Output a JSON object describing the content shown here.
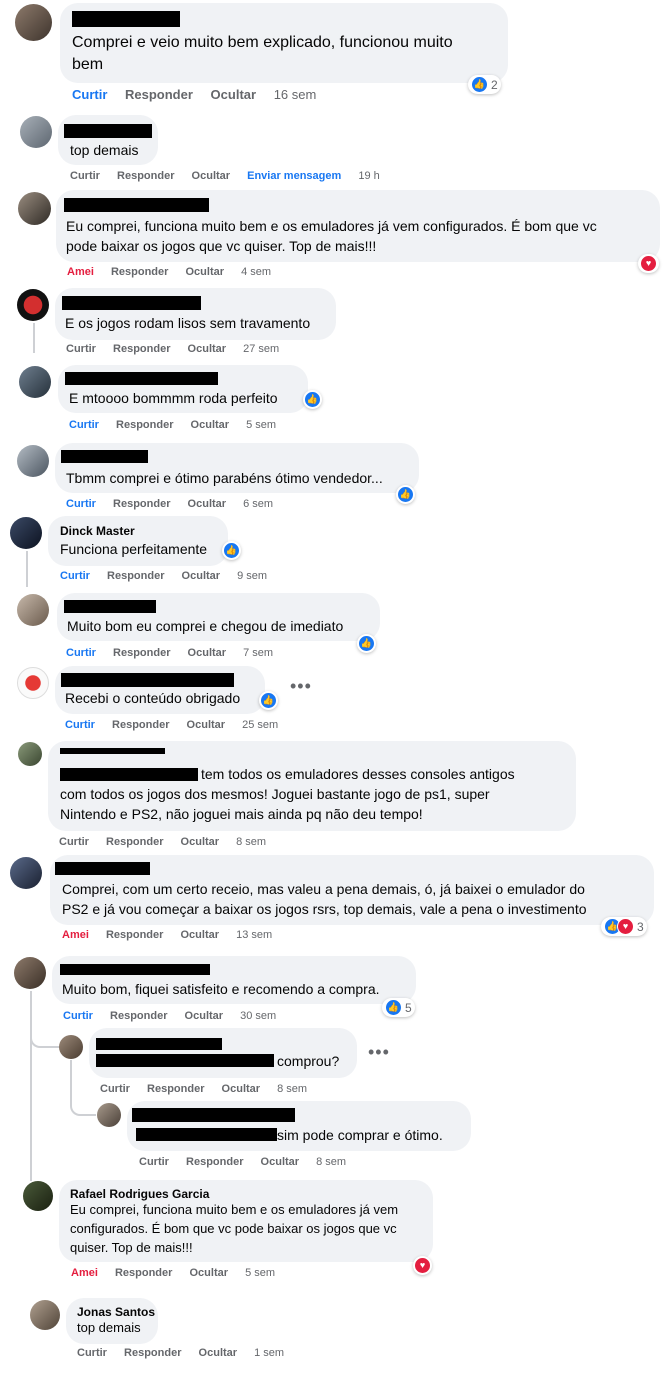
{
  "actions": {
    "like": "Curtir",
    "loved": "Amei",
    "reply": "Responder",
    "hide": "Ocultar",
    "send_message": "Enviar mensagem"
  },
  "comments": [
    {
      "text": "Comprei e veio muito bem explicado, funcionou muito",
      "text2": "bem",
      "reaction_count": "2",
      "time": "16 sem",
      "reaction": "like"
    },
    {
      "text": "top demais",
      "time": "19 h"
    },
    {
      "text": "Eu comprei, funciona muito bem e os emuladores já vem configurados. É bom que vc",
      "text2": "pode baixar os jogos que vc quiser. Top de mais!!!",
      "time": "4 sem",
      "reaction": "love"
    },
    {
      "text": "E os jogos rodam lisos sem travamento",
      "time": "27 sem"
    },
    {
      "text": "E mtoooo bommmm roda perfeito",
      "time": "5 sem",
      "reaction": "like"
    },
    {
      "text": "Tbmm comprei e ótimo parabéns ótimo vendedor...",
      "time": "6 sem",
      "reaction": "like"
    },
    {
      "name": "Dinck Master",
      "text": "Funciona perfeitamente",
      "time": "9 sem",
      "reaction": "like"
    },
    {
      "text": "Muito bom eu comprei e chegou de imediato",
      "time": "7 sem",
      "reaction": "like"
    },
    {
      "text": "Recebi o conteúdo obrigado",
      "time": "25 sem",
      "reaction": "like"
    },
    {
      "text": "tem todos os emuladores desses consoles antigos",
      "text2": "com todos os jogos dos mesmos! Joguei bastante jogo de ps1, super",
      "text3": "Nintendo e PS2, não joguei mais ainda pq não deu tempo!",
      "time": "8 sem"
    },
    {
      "text": "Comprei, com um certo receio, mas valeu a pena demais, ó, já baixei o emulador do",
      "text2": "PS2 e já vou começar a baixar os jogos rsrs, top demais, vale a pena o investimento",
      "reaction_count": "3",
      "time": "13 sem",
      "reaction": "like+love"
    },
    {
      "text": "Muito bom, fiquei satisfeito e recomendo a compra.",
      "reaction_count": "5",
      "time": "30 sem",
      "reaction": "like"
    },
    {
      "text": "comprou?",
      "time": "8 sem"
    },
    {
      "text": "sim pode comprar e ótimo.",
      "time": "8 sem"
    },
    {
      "name": "Rafael Rodrigues Garcia",
      "text": "Eu comprei, funciona muito bem e os emuladores já vem",
      "text2": "configurados. É bom que vc pode baixar os jogos que vc",
      "text3": "quiser. Top de mais!!!",
      "time": "5 sem",
      "reaction": "love"
    },
    {
      "name": "Jonas Santos",
      "text": "top demais",
      "time": "1 sem"
    }
  ],
  "icons": {
    "like": "thumbs-up-icon",
    "love": "heart-icon",
    "more": "more-options-icon"
  },
  "colors": {
    "bubble": "#f0f2f5",
    "like": "#1877f2",
    "love": "#e41e3f",
    "meta": "#65676b"
  }
}
